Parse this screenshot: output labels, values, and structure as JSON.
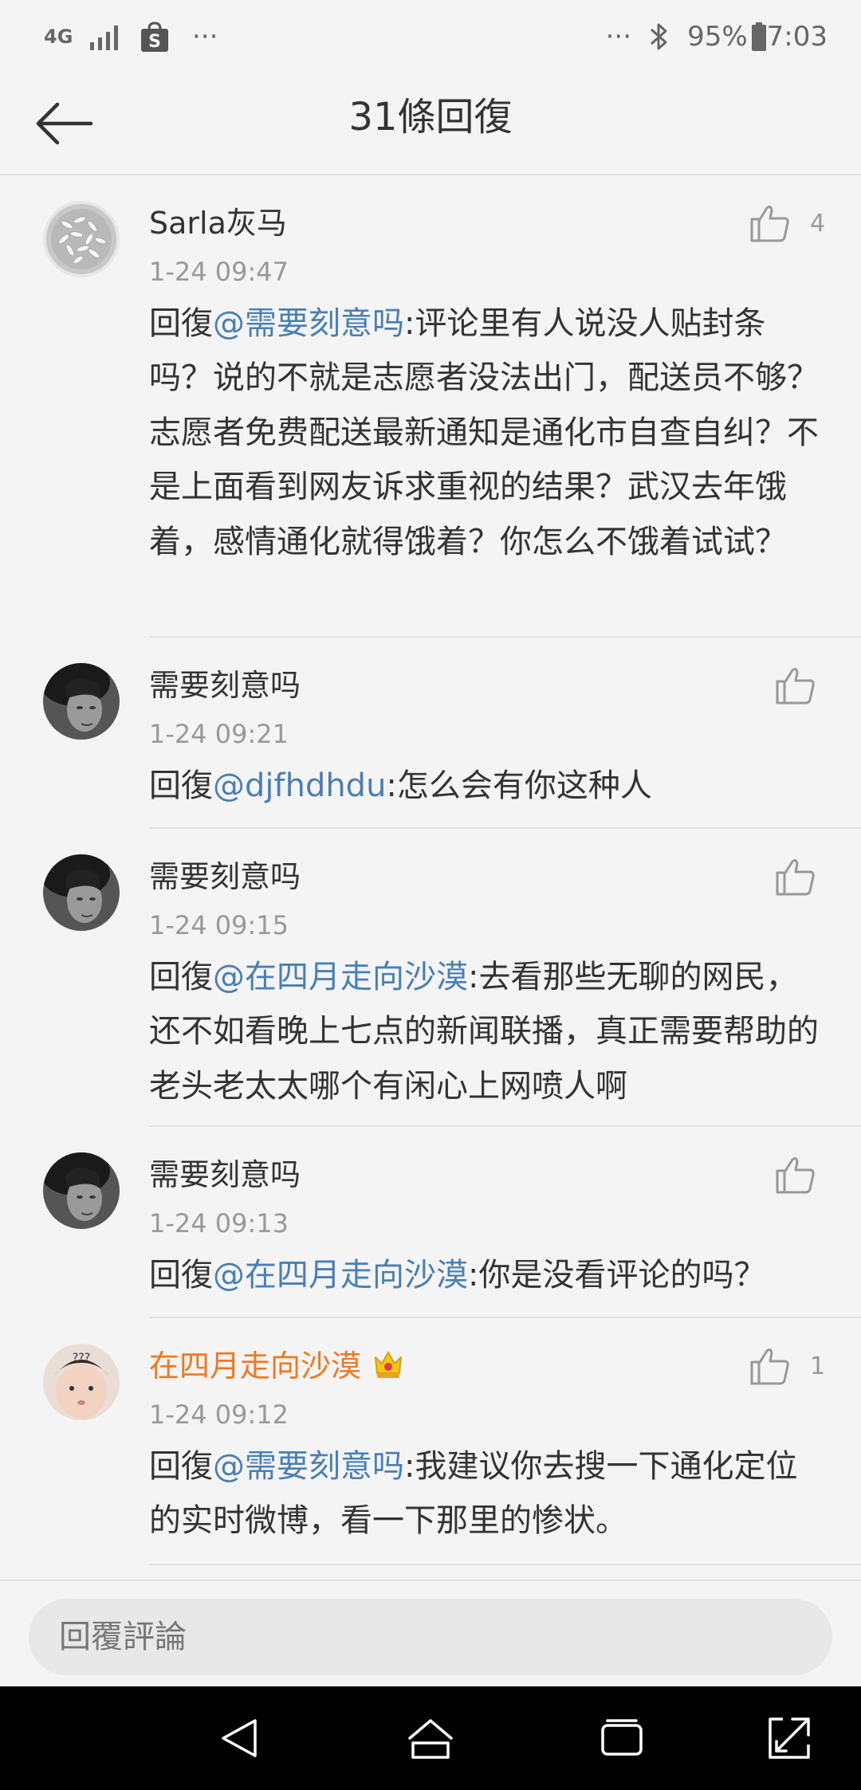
{
  "status_bar": {
    "network": "4G",
    "left_dots": "···",
    "right_dots": "···",
    "battery": "95%",
    "time": "7:03"
  },
  "header": {
    "title": "31條回復"
  },
  "comments": [
    {
      "name": "Sarla灰马",
      "time": "1-24 09:47",
      "reply_prefix": "回復",
      "mention": "@需要刻意吗",
      "text": ":评论里有人说没人贴封条吗？说的不就是志愿者没法出门，配送员不够？志愿者免费配送最新通知是通化市自查自纠？不是上面看到网友诉求重视的结果？武汉去年饿着，感情通化就得饿着？你怎么不饿着试试？",
      "likes": "4"
    },
    {
      "name": "需要刻意吗",
      "time": "1-24 09:21",
      "reply_prefix": "回復",
      "mention": "@djfhdhdu",
      "text": ":怎么会有你这种人",
      "likes": ""
    },
    {
      "name": "需要刻意吗",
      "time": "1-24 09:15",
      "reply_prefix": "回復",
      "mention": "@在四月走向沙漠",
      "text": ":去看那些无聊的网民，还不如看晚上七点的新闻联播，真正需要帮助的老头老太太哪个有闲心上网喷人啊",
      "likes": ""
    },
    {
      "name": "需要刻意吗",
      "time": "1-24 09:13",
      "reply_prefix": "回復",
      "mention": "@在四月走向沙漠",
      "text": ":你是没看评论的吗？",
      "likes": ""
    },
    {
      "name": "在四月走向沙漠",
      "time": "1-24 09:12",
      "reply_prefix": "回復",
      "mention": "@需要刻意吗",
      "text": ":我建议你去搜一下通化定位的实时微博，看一下那里的惨状。",
      "likes": "1"
    }
  ],
  "reply_bar": {
    "placeholder": "回覆評論"
  },
  "colors": {
    "mention": "#4a7fb5",
    "vip_name": "#f07822",
    "background": "#f4f4f4"
  },
  "icons": [
    "back-arrow-icon",
    "thumbs-up-icon",
    "crown-badge-icon",
    "bluetooth-icon",
    "battery-icon",
    "signal-icon",
    "shop-bag-icon",
    "nav-back-icon",
    "nav-home-icon",
    "nav-recents-icon",
    "nav-expand-icon"
  ]
}
